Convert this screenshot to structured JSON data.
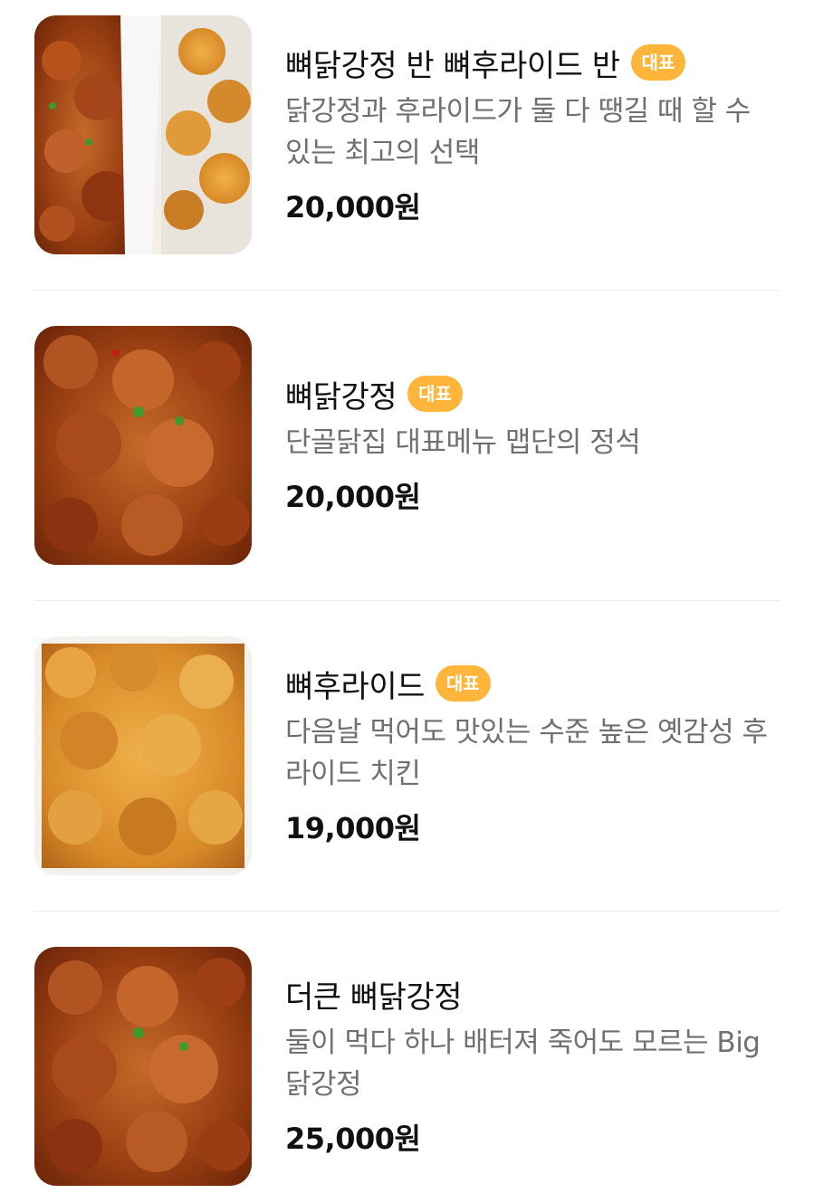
{
  "menu": {
    "items": [
      {
        "name": "뼈닭강정 반 뼈후라이드 반",
        "badge": "대표",
        "description": "닭강정과 후라이드가 둘 다 땡길 때 할 수 있는 최고의 선택",
        "price": "20,000원",
        "image": "half-and-half-chicken-photo"
      },
      {
        "name": "뼈닭강정",
        "badge": "대표",
        "description": "단골닭집 대표메뉴 맵단의 정석",
        "price": "20,000원",
        "image": "sweet-spicy-chicken-photo"
      },
      {
        "name": "뼈후라이드",
        "badge": "대표",
        "description": "다음날 먹어도 맛있는 수준 높은 옛감성 후라이드 치킨",
        "price": "19,000원",
        "image": "fried-chicken-photo"
      },
      {
        "name": "더큰 뼈닭강정",
        "badge": "",
        "description": "둘이 먹다 하나 배터져 죽어도 모르는 Big닭강정",
        "price": "25,000원",
        "image": "big-sweet-spicy-chicken-photo"
      }
    ]
  },
  "colors": {
    "badge": "#ffb53a",
    "description": "#707070",
    "divider": "#ececec"
  }
}
